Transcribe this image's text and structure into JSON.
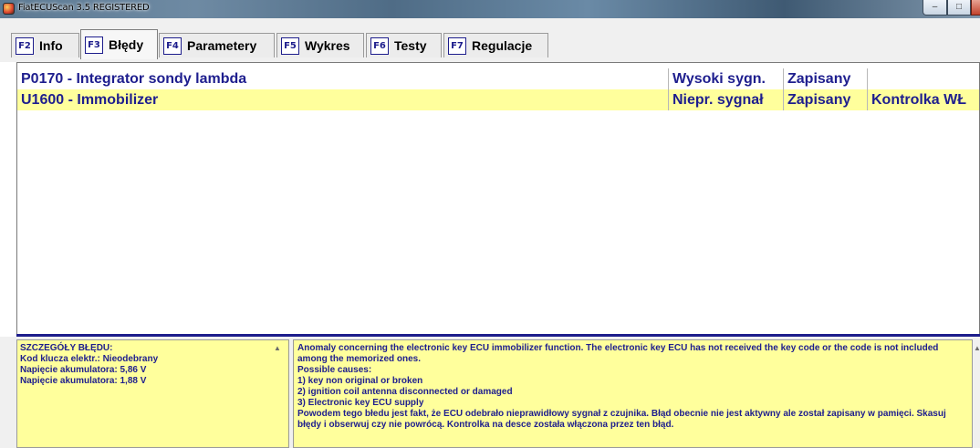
{
  "window": {
    "title": "FiatECUScan 3.5 REGISTERED",
    "minimize_glyph": "–",
    "maximize_glyph": "□"
  },
  "tabs": [
    {
      "key": "F2",
      "label": "Info",
      "active": false
    },
    {
      "key": "F3",
      "label": "Błędy",
      "active": true
    },
    {
      "key": "F4",
      "label": "Parametery",
      "active": false
    },
    {
      "key": "F5",
      "label": "Wykres",
      "active": false
    },
    {
      "key": "F6",
      "label": "Testy",
      "active": false
    },
    {
      "key": "F7",
      "label": "Regulacje",
      "active": false
    }
  ],
  "errors": [
    {
      "code_desc": "P0170 - Integrator sondy lambda",
      "signal": "Wysoki sygn.",
      "status": "Zapisany",
      "lamp": ""
    },
    {
      "code_desc": "U1600 - Immobilizer",
      "signal": "Niepr. sygnał",
      "status": "Zapisany",
      "lamp": "Kontrolka WŁ"
    }
  ],
  "details_left": {
    "heading": "SZCZEGÓŁY BŁĘDU:",
    "lines": [
      "Kod klucza elektr.: Nieodebrany",
      "Napięcie akumulatora: 5,86 V",
      "Napięcie akumulatora: 1,88 V"
    ]
  },
  "details_right": {
    "description": "Anomaly concerning the electronic key ECU immobilizer function. The electronic key ECU has not received the key code or the code is not included among the memorized ones.",
    "causes_heading": "Possible causes:",
    "causes": [
      "1) key non original or broken",
      "2) ignition coil antenna disconnected or damaged",
      "3) Electronic key ECU supply"
    ],
    "polish_note": "Powodem tego błedu jest fakt, że ECU odebrało nieprawidłowy sygnał z czujnika. Błąd obecnie nie jest aktywny ale został zapisany w pamięci. Skasuj błędy i obserwuj czy nie powrócą. Kontrolka na desce została włączona przez ten błąd."
  },
  "colors": {
    "text_blue": "#1e1e8e",
    "highlight_yellow": "#ffff9c"
  }
}
